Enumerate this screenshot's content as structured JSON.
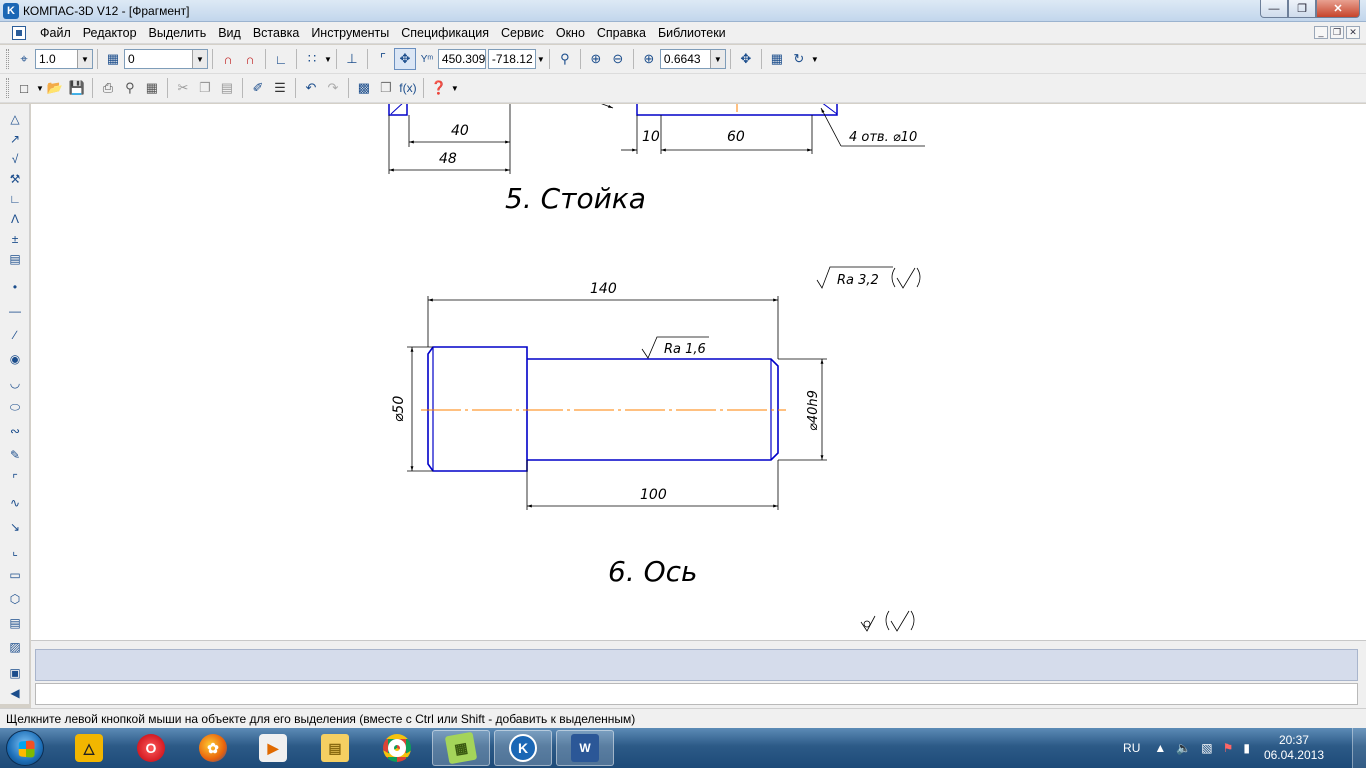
{
  "window": {
    "title": "КОМПАС-3D V12 - [Фрагмент]",
    "app_icon_letter": "K"
  },
  "menu": {
    "items": [
      "Файл",
      "Редактор",
      "Выделить",
      "Вид",
      "Вставка",
      "Инструменты",
      "Спецификация",
      "Сервис",
      "Окно",
      "Справка",
      "Библиотеки"
    ]
  },
  "toolbar1": {
    "step": "1.0",
    "layer": "0",
    "coord_x": "450.309",
    "coord_y": "-718.12",
    "zoom": "0.6643"
  },
  "drawing": {
    "stoyka": {
      "title": "5. Стойка",
      "dim_40": "40",
      "dim_48": "48",
      "dim_10": "10",
      "dim_60": "60",
      "holes": "4 отв. ⌀10"
    },
    "os": {
      "title": "6. Ось",
      "dim_140": "140",
      "dim_100": "100",
      "dia_50": "⌀50",
      "dia_40": "⌀40h9",
      "rough_ra16": "Ra 1,6",
      "rough_ra32": "Ra 3,2"
    },
    "colors": {
      "outline": "#0000c8",
      "axis": "#ff8000",
      "dims": "#000000"
    }
  },
  "statusbar": {
    "text": "Щелкните левой кнопкой мыши на объекте для его выделения (вместе с Ctrl или Shift - добавить к выделенным)"
  },
  "taskbar": {
    "apps": [
      "autodesk",
      "opera",
      "firefox",
      "media",
      "explorer",
      "chrome",
      "files",
      "kompas",
      "word"
    ],
    "lang": "RU",
    "time": "20:37",
    "date": "06.04.2013"
  }
}
